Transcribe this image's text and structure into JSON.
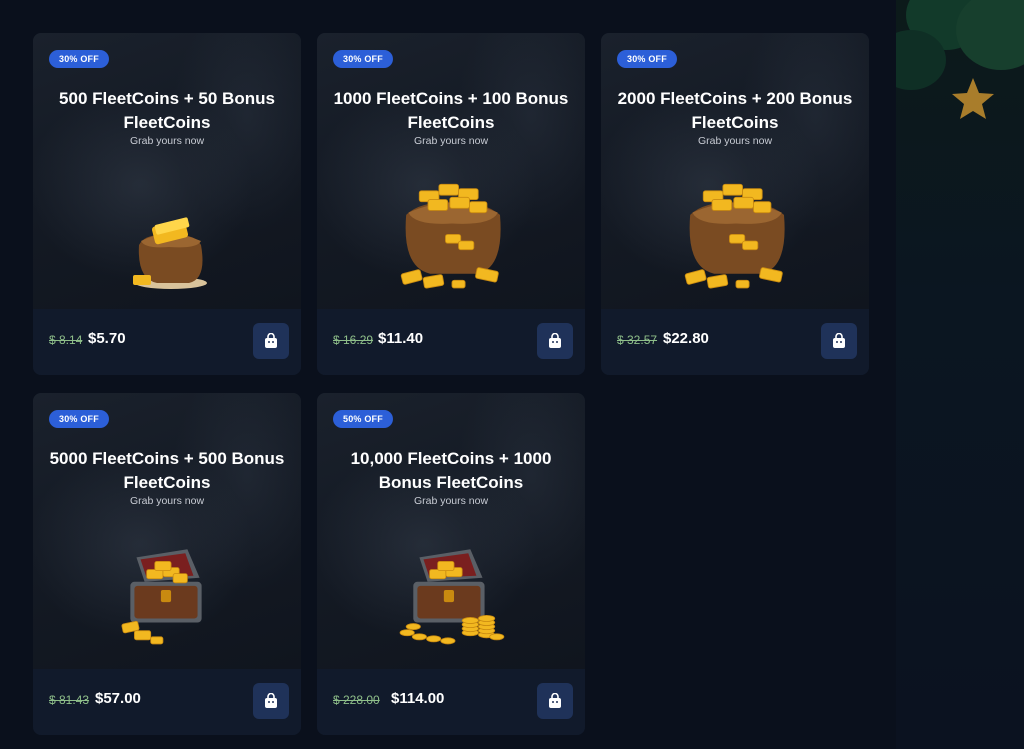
{
  "offers": [
    {
      "badge": "30% OFF",
      "title": "500 FleetCoins + 50 Bonus FleetCoins",
      "subtitle": "Grab yours now",
      "old_price": "$ 8.14",
      "new_price": "$5.70",
      "illustration": "small-gold-bag-icon"
    },
    {
      "badge": "30% OFF",
      "title": "1000 FleetCoins + 100 Bonus FleetCoins",
      "subtitle": "Grab yours now",
      "old_price": "$ 16.29",
      "new_price": "$11.40",
      "illustration": "gold-sack-icon"
    },
    {
      "badge": "30% OFF",
      "title": "2000 FleetCoins + 200 Bonus FleetCoins",
      "subtitle": "Grab yours now",
      "old_price": "$ 32.57",
      "new_price": "$22.80",
      "illustration": "gold-sack-icon"
    },
    {
      "badge": "30% OFF",
      "title": "5000 FleetCoins + 500 Bonus FleetCoins",
      "subtitle": "Grab yours now",
      "old_price": "$ 81.43",
      "new_price": "$57.00",
      "illustration": "treasure-chest-icon"
    },
    {
      "badge": "50% OFF",
      "title": "10,000 FleetCoins + 1000 Bonus FleetCoins",
      "subtitle": "Grab yours now",
      "old_price": "$ 228.00",
      "new_price": "$114.00",
      "illustration": "treasure-chest-coins-icon"
    }
  ],
  "cart_icon": "shopping-bag-icon",
  "colors": {
    "badge": "#2c5fd8",
    "cart_button": "#1f3259",
    "old_price": "#8fbf8a",
    "background": "#0a101c"
  }
}
